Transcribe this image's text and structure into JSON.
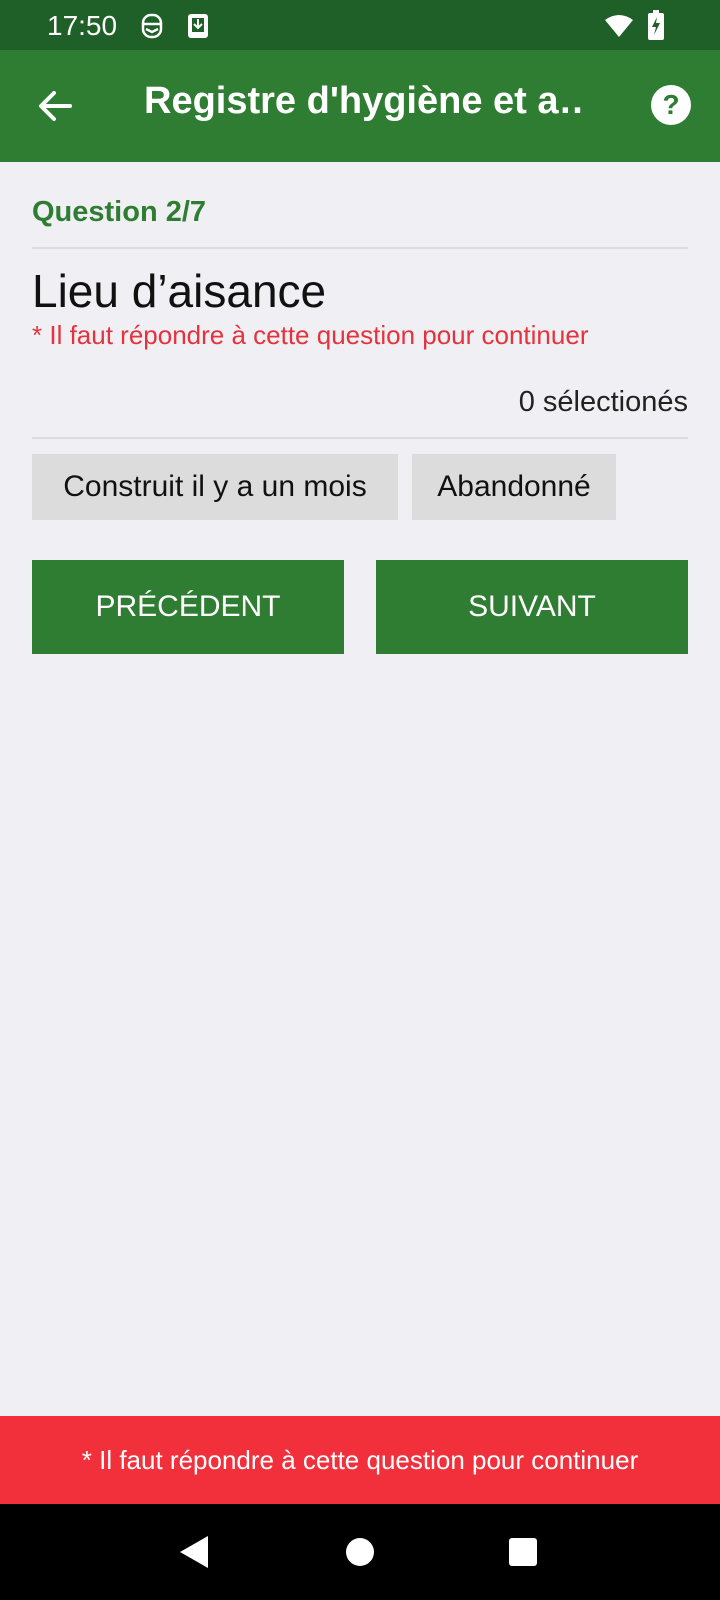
{
  "status_bar": {
    "time": "17:50",
    "icons": [
      "notification-app-icon",
      "download-icon"
    ],
    "right_icons": [
      "wifi-icon",
      "battery-charging-icon"
    ]
  },
  "app_bar": {
    "title": "Registre d'hygiène et a…",
    "back_icon": "arrow-left-icon",
    "help_icon": "help-circle-icon"
  },
  "question": {
    "number": "Question 2/7",
    "title": "Lieu d’aisance",
    "required_text": "* Il faut répondre  à cette question pour continuer",
    "selected_count": "0 sélectionés"
  },
  "options": [
    {
      "label": "Construit il y a un mois"
    },
    {
      "label": "Abandonné"
    }
  ],
  "buttons": {
    "previous": "PRÉCÉDENT",
    "next": "SUIVANT"
  },
  "snackbar": {
    "text": "* Il faut répondre  à cette question pour continuer"
  },
  "colors": {
    "primary": "#2e7d32",
    "status_bar": "#1f5f28",
    "error": "#e5323c",
    "snackbar": "#f1303b",
    "background": "#efeff4",
    "chip": "#dcdcdc"
  }
}
